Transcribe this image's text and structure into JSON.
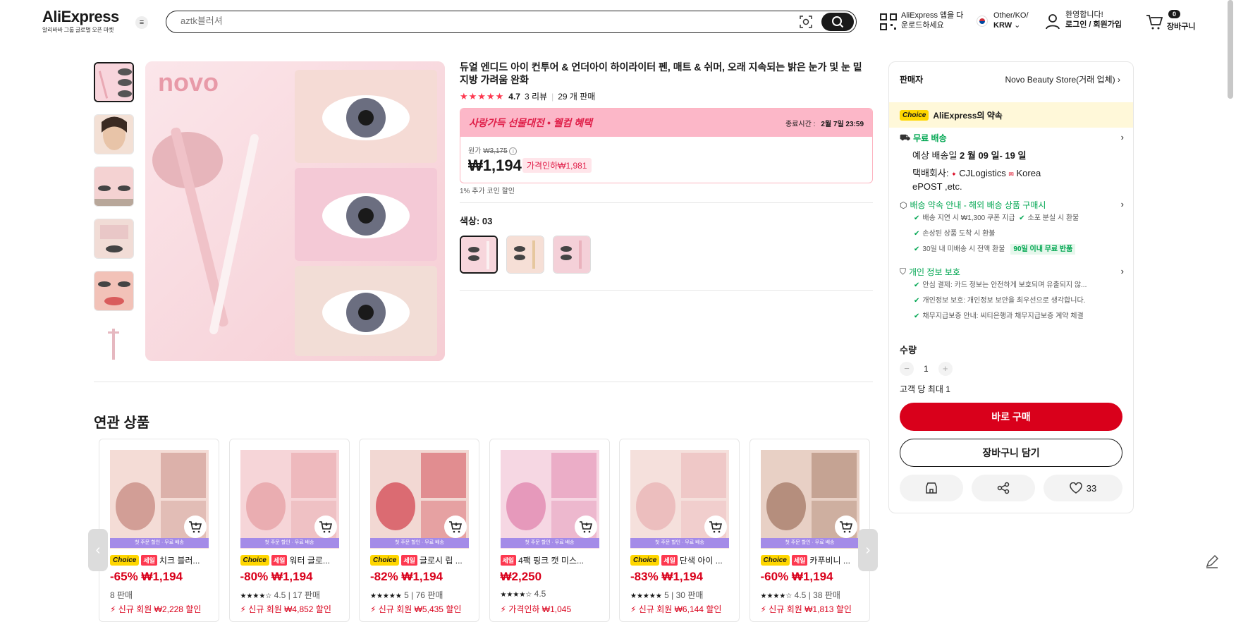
{
  "header": {
    "logo": "AliExpress",
    "logo_sub": "알리바바 그룹 글로벌 오픈 마켓",
    "search_placeholder": "aztk블러셔",
    "app_line1": "AliExpress 앱을 다",
    "app_line2": "운로드하세요",
    "lang_line1": "Other/KO/",
    "lang_line2": "KRW",
    "user_line1": "환영합니다!",
    "user_line2": "로그인 / 회원가입",
    "cart_count": "0",
    "cart_label": "장바구니"
  },
  "product": {
    "title": "듀얼 엔디드 아이 컨투어 & 언더아이 하이라이터 펜, 매트 & 쉬머, 오래 지속되는 밝은 눈가 및 눈 밑 지방 가려움 완화",
    "rating": "4.7",
    "reviews": "3 리뷰",
    "sold": "29 개 판매",
    "promo_title_a": "사랑가득 선물대전",
    "promo_title_b": " • 웰컴 혜택",
    "end_label": "종료시간 :",
    "end_time": "2월 7일 23:59",
    "orig_label": "원가",
    "orig_price": "₩3,175",
    "price": "₩1,194",
    "discount": "가격인하₩1,981",
    "coin": "1% 추가 코인 할인",
    "color_label": "색상: 03",
    "brand_text": "novo"
  },
  "panel": {
    "seller_label": "판매자",
    "seller_name": "Novo Beauty Store(거래 업체)",
    "choice": "Choice",
    "promise": "AliExpress의 약속",
    "ship_title": "무료 배송",
    "ship_eta_label": "예상 배송일 ",
    "ship_eta": "2 월 09 일- 19 일",
    "carrier_label": "택배회사: ",
    "carrier1": "CJLogistics",
    "carrier2": "Korea",
    "carrier3": "ePOST ,etc.",
    "guide_title": "배송 약속 안내 - 해외 배송 상품 구매시",
    "g1": "배송 지연 시 ₩1,300 쿠폰 지급",
    "g2": "소포 분실 시 환불",
    "g3": "손상된 상품 도착 시 환불",
    "g4": "30일 내 미배송 시 전액 환불",
    "g5": "90일 이내 무료 반품",
    "privacy_title": "개인 정보 보호",
    "p1": "안심 결제: 카드 정보는 안전하게 보호되며 유출되지 않...",
    "p2": "개인정보 보호: 개인정보 보안을 최우선으로 생각합니다.",
    "p3": "채무지급보증 안내: 씨티은행과 채무지급보증 계약 체결",
    "qty_label": "수량",
    "qty": "1",
    "max_qty": "고객 당 최대 1",
    "buy": "바로 구매",
    "add_cart": "장바구니 담기",
    "wish": "33"
  },
  "related": {
    "heading": "연관 상품",
    "promo": "첫 주문 할인 · 무료 배송",
    "items": [
      {
        "choice": "Choice",
        "sale": "세일",
        "name": "치크 블러...",
        "price": "-65% ₩1,194",
        "meta": "8 판매",
        "stars": "",
        "new": "신규 회원 ₩2,228 할인"
      },
      {
        "choice": "Choice",
        "sale": "세일",
        "name": "워터 글로...",
        "price": "-80% ₩1,194",
        "meta": "4.5 | 17 판매",
        "stars": "★★★★☆",
        "new": "신규 회원 ₩4,852 할인"
      },
      {
        "choice": "Choice",
        "sale": "세일",
        "name": "글로시 립 ...",
        "price": "-82% ₩1,194",
        "meta": "5 | 76 판매",
        "stars": "★★★★★",
        "new": "신규 회원 ₩5,435 할인"
      },
      {
        "choice": "",
        "sale": "세일",
        "name": "4팩 핑크 캣 미스...",
        "price": "₩2,250",
        "meta": "4.5",
        "stars": "★★★★☆",
        "new": "가격인하 ₩1,045"
      },
      {
        "choice": "Choice",
        "sale": "세일",
        "name": "단색 아이 ...",
        "price": "-83% ₩1,194",
        "meta": "5 | 30 판매",
        "stars": "★★★★★",
        "new": "신규 회원 ₩6,144 할인"
      },
      {
        "choice": "Choice",
        "sale": "세일",
        "name": "카푸비니 ...",
        "price": "-60% ₩1,194",
        "meta": "4.5 | 38 판매",
        "stars": "★★★★☆",
        "new": "신규 회원 ₩1,813 할인"
      }
    ]
  },
  "colors": {
    "accent": "#d9001b",
    "pink": "#fcb7c8",
    "green": "#00a651",
    "choice": "#ffd600"
  }
}
